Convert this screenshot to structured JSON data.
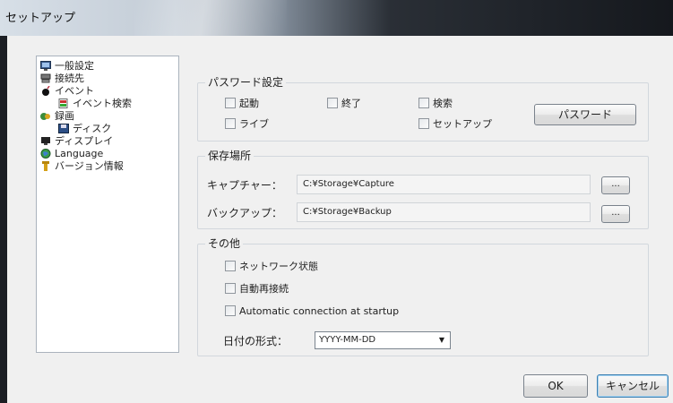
{
  "window": {
    "title": "セットアップ"
  },
  "tree": {
    "items": [
      {
        "label": "一般設定",
        "icon": "monitor-icon"
      },
      {
        "label": "接続先",
        "icon": "network-icon"
      },
      {
        "label": "イベント",
        "icon": "bomb-icon"
      },
      {
        "label": "イベント検索",
        "icon": "document-search-icon"
      },
      {
        "label": "録画",
        "icon": "record-icon"
      },
      {
        "label": "ディスク",
        "icon": "disk-icon"
      },
      {
        "label": "ディスプレイ",
        "icon": "display-icon"
      },
      {
        "label": "Language",
        "icon": "globe-icon"
      },
      {
        "label": "バージョン情報",
        "icon": "info-icon"
      }
    ]
  },
  "password_group": {
    "title": "パスワード設定",
    "checks": [
      "起動",
      "終了",
      "検索",
      "ライブ",
      "セットアップ"
    ],
    "button_label": "パスワード"
  },
  "storage_group": {
    "title": "保存場所",
    "capture_label": "キャプチャー：",
    "capture_path": "C:¥Storage¥Capture",
    "backup_label": "バックアップ：",
    "backup_path": "C:¥Storage¥Backup",
    "browse_label": "..."
  },
  "other_group": {
    "title": "その他",
    "checks": [
      "ネットワーク状態",
      "自動再接続",
      "Automatic connection at startup"
    ],
    "date_format_label": "日付の形式：",
    "date_format_value": "YYYY-MM-DD"
  },
  "footer": {
    "ok_label": "OK",
    "cancel_label": "キャンセル"
  },
  "colors": {
    "titlebar_dark": "#15181d",
    "titlebar_light": "#d7dfe7",
    "face": "#f0f0f0"
  }
}
